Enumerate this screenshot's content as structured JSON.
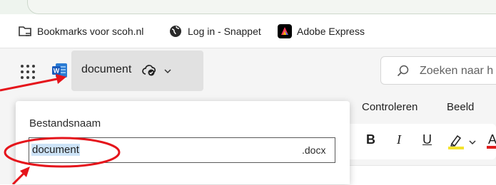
{
  "bookmarks": [
    {
      "label": "Bookmarks voor scoh.nl",
      "icon": "bookmark-folder-icon"
    },
    {
      "label": "Log in - Snappet",
      "icon": "globe-icon"
    },
    {
      "label": "Adobe Express",
      "icon": "adobe-express-icon"
    }
  ],
  "titlebar": {
    "document_name": "document",
    "app_icon": "word-icon",
    "search_placeholder": "Zoeken naar h"
  },
  "ribbon": {
    "menu_items": [
      "Controleren",
      "Beeld"
    ],
    "format_buttons": [
      "B",
      "I",
      "U",
      "A"
    ]
  },
  "rename_panel": {
    "label": "Bestandsnaam",
    "filename": "document",
    "extension": ".docx"
  },
  "colors": {
    "annotation": "#e5141b",
    "highlight_yellow": "#f4e32d",
    "font_color_red": "#e01b1b",
    "selection": "#cde3f7",
    "word_blue": "#185abd"
  }
}
